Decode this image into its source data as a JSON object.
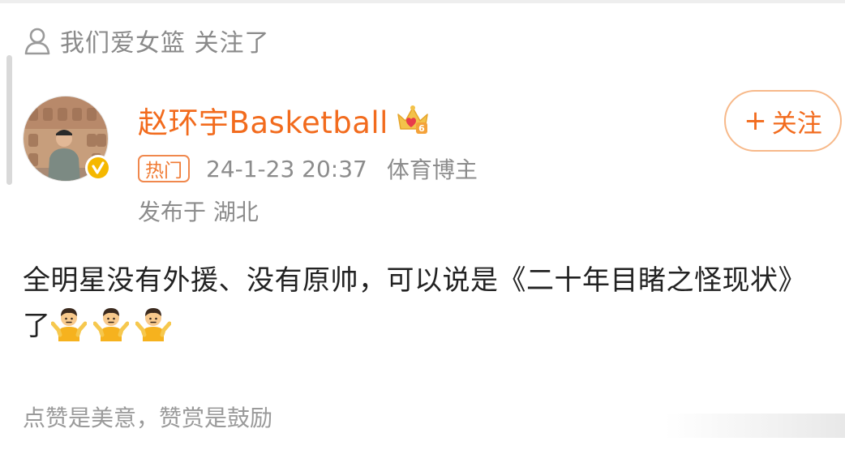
{
  "follow_notice": {
    "text": "我们爱女篮 关注了",
    "icon": "person-icon"
  },
  "author": {
    "name": "赵环宇Basketball",
    "avatar": "avatar",
    "verified_icon": "verified-badge-icon",
    "crown_icon": "crown-icon",
    "crown_level": "6",
    "name_color": "#f26b1d"
  },
  "follow_button": {
    "icon": "plus-icon",
    "label": "关注",
    "plus": "+"
  },
  "meta": {
    "tag": "热门",
    "time": "24-1-23 20:37",
    "category": "体育博主",
    "location": "发布于 湖北"
  },
  "post": {
    "text": "全明星没有外援、没有原帅，可以说是《二十年目睹之怪现状》了",
    "emoji_icon": "shrug-emoji-icon",
    "emoji_count": 3
  },
  "footer": {
    "reward_text": "点赞是美意，赞赏是鼓励"
  },
  "colors": {
    "accent": "#f26b1d",
    "meta_gray": "#8c8c8c",
    "emoji_yellow": "#f6b21e",
    "verified_gold": "#f5b800"
  }
}
